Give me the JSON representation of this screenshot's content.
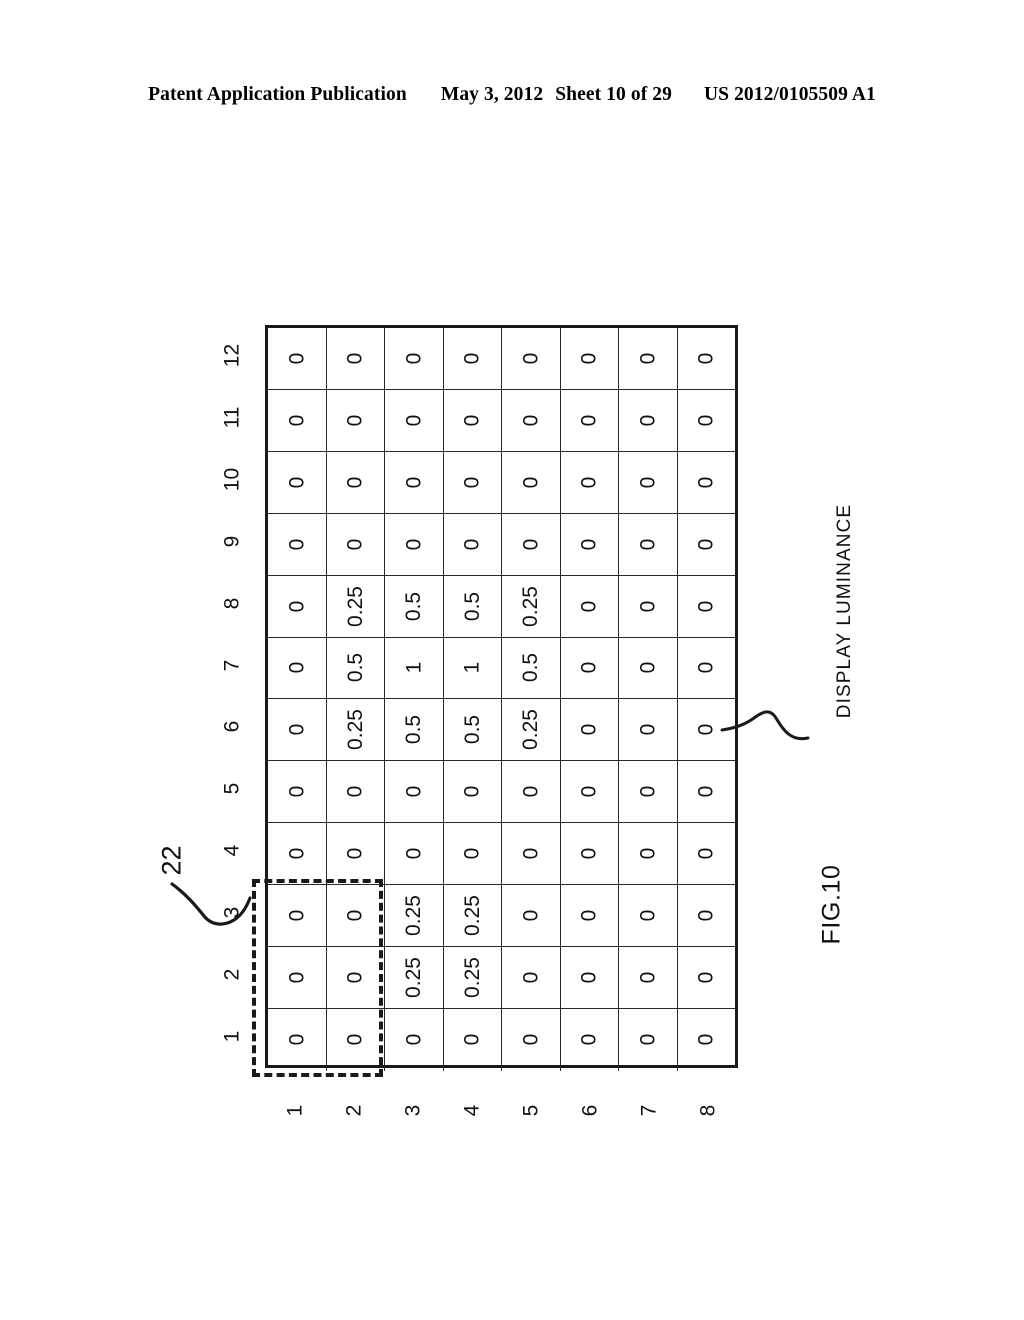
{
  "header": {
    "publication": "Patent Application Publication",
    "date": "May 3, 2012",
    "sheet": "Sheet 10 of 29",
    "number": "US 2012/0105509 A1"
  },
  "figure": {
    "caption": "FIG.10",
    "callout_label": "22",
    "luminance_label": "DISPLAY LUMINANCE"
  },
  "chart_data": {
    "type": "heatmap",
    "title": "FIG.10",
    "description": "Display luminance map of an 8 x 12 backlight / pixel block array with point-spread values",
    "xlabel": "",
    "ylabel": "",
    "legend_position": "none",
    "grid": true,
    "column_labels": [
      "1",
      "2",
      "3",
      "4",
      "5",
      "6",
      "7",
      "8",
      "9",
      "10",
      "11",
      "12"
    ],
    "row_labels": [
      "1",
      "2",
      "3",
      "4",
      "5",
      "6",
      "7",
      "8"
    ],
    "value_set": [
      "0",
      "0.25",
      "0.5",
      "1"
    ],
    "rows": [
      {
        "row": "1",
        "values": [
          "0",
          "0",
          "0",
          "0",
          "0",
          "0",
          "0",
          "0",
          "0",
          "0",
          "0",
          "0"
        ]
      },
      {
        "row": "2",
        "values": [
          "0",
          "0",
          "0",
          "0",
          "0",
          "0.25",
          "0.5",
          "0.25",
          "0",
          "0",
          "0",
          "0"
        ]
      },
      {
        "row": "3",
        "values": [
          "0",
          "0.25",
          "0.25",
          "0",
          "0",
          "0.5",
          "1",
          "0.5",
          "0",
          "0",
          "0",
          "0"
        ]
      },
      {
        "row": "4",
        "values": [
          "0",
          "0.25",
          "0.25",
          "0",
          "0",
          "0.5",
          "1",
          "0.5",
          "0",
          "0",
          "0",
          "0"
        ]
      },
      {
        "row": "5",
        "values": [
          "0",
          "0",
          "0",
          "0",
          "0",
          "0.25",
          "0.5",
          "0.25",
          "0",
          "0",
          "0",
          "0"
        ]
      },
      {
        "row": "6",
        "values": [
          "0",
          "0",
          "0",
          "0",
          "0",
          "0",
          "0",
          "0",
          "0",
          "0",
          "0",
          "0"
        ]
      },
      {
        "row": "7",
        "values": [
          "0",
          "0",
          "0",
          "0",
          "0",
          "0",
          "0",
          "0",
          "0",
          "0",
          "0",
          "0"
        ]
      },
      {
        "row": "8",
        "values": [
          "0",
          "0",
          "0",
          "0",
          "0",
          "0",
          "0",
          "0",
          "0",
          "0",
          "0",
          "0"
        ]
      }
    ],
    "annotations": [
      {
        "label": "22",
        "kind": "dashed-region",
        "covers_columns": [
          "1",
          "2",
          "3"
        ],
        "covers_rows": [
          "1",
          "2"
        ]
      },
      {
        "label": "DISPLAY LUMINANCE",
        "kind": "leader",
        "points_to_column": "6",
        "points_to_row": "8"
      }
    ]
  }
}
